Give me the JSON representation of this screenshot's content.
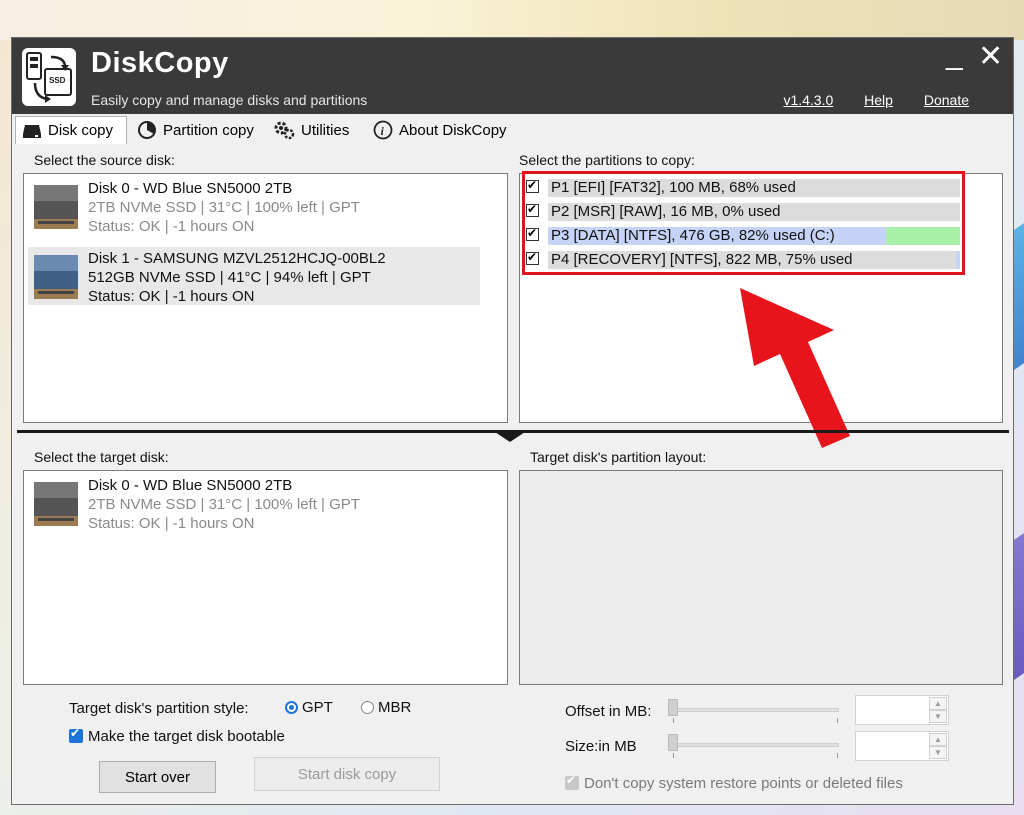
{
  "window": {
    "title": "DiskCopy",
    "subtitle": "Easily copy and manage disks and partitions",
    "version": "v1.4.3.0",
    "help": "Help",
    "donate": "Donate",
    "minimize_glyph": "_",
    "close_glyph": "✕"
  },
  "tabs": [
    {
      "label": "Disk copy",
      "icon": "disk-icon",
      "active": true
    },
    {
      "label": "Partition copy",
      "icon": "partition-icon",
      "active": false
    },
    {
      "label": "Utilities",
      "icon": "gears-icon",
      "active": false
    },
    {
      "label": "About DiskCopy",
      "icon": "info-icon",
      "active": false
    }
  ],
  "source": {
    "label": "Select the source disk:",
    "disks": [
      {
        "name": "Disk 0 - WD Blue SN5000 2TB",
        "detail": "2TB NVMe SSD | 31°C | 100% left | GPT",
        "status": "Status: OK | -1 hours ON",
        "selected": false
      },
      {
        "name": "Disk 1 - SAMSUNG MZVL2512HCJQ-00BL2",
        "detail": "512GB NVMe SSD | 41°C | 94% left | GPT",
        "status": "Status: OK | -1 hours ON",
        "selected": true
      }
    ]
  },
  "partitions": {
    "label": "Select the partitions to copy:",
    "items": [
      {
        "text": "P1 [EFI] [FAT32], 100 MB, 68% used",
        "checked": true,
        "used_fraction": 0.68,
        "color": "#dcdcdc"
      },
      {
        "text": "P2 [MSR] [RAW], 16 MB, 0% used",
        "checked": true,
        "used_fraction": 0.0,
        "color": "#dcdcdc"
      },
      {
        "text": "P3 [DATA] [NTFS], 476 GB, 82% used (C:)",
        "checked": true,
        "used_fraction": 0.82,
        "color": "#c5d3f6"
      },
      {
        "text": "P4 [RECOVERY] [NTFS], 822 MB, 75% used",
        "checked": true,
        "used_fraction": 0.99,
        "color": "#dcdcdc"
      }
    ]
  },
  "target": {
    "label": "Select the target disk:",
    "disks": [
      {
        "name": "Disk 0 - WD Blue SN5000 2TB",
        "detail": "2TB NVMe SSD | 31°C | 100% left | GPT",
        "status": "Status: OK | -1 hours ON"
      }
    ],
    "layout_label": "Target disk's partition layout:"
  },
  "options": {
    "partition_style_label": "Target disk's partition style:",
    "gpt": "GPT",
    "mbr": "MBR",
    "selected_style": "GPT",
    "bootable_label": "Make the target disk bootable",
    "bootable_checked": true,
    "start_over": "Start over",
    "start_copy": "Start disk copy",
    "offset_label": "Offset in MB:",
    "size_label": "Size:in MB",
    "restore_points_label": "Don't copy system restore points or deleted files",
    "restore_points_checked": true
  },
  "colors": {
    "titlebar": "#3a3a3a",
    "highlight_box": "#e0141c",
    "arrow": "#e8141c",
    "free_space": "#a8f0a8",
    "accent": "#1e73d8"
  }
}
